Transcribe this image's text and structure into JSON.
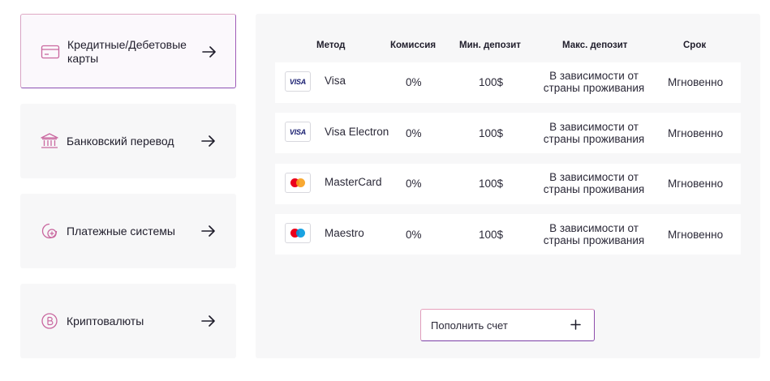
{
  "sidebar": {
    "items": [
      {
        "label_line1": "Кредитные/Дебетовые",
        "label_line2": "карты",
        "icon": "credit-card-icon",
        "active": true
      },
      {
        "label": "Банковский перевод",
        "icon": "bank-icon"
      },
      {
        "label": "Платежные системы",
        "icon": "payment-systems-icon"
      },
      {
        "label": "Криптовалюты",
        "icon": "crypto-icon"
      }
    ]
  },
  "table": {
    "headers": {
      "method": "Метод",
      "fee": "Комиссия",
      "min": "Мин. депозит",
      "max": "Макс. депозит",
      "time": "Срок"
    },
    "rows": [
      {
        "logo": "visa-logo",
        "method": "Visa",
        "fee": "0%",
        "min": "100$",
        "max_line1": "В зависимости от",
        "max_line2": "страны проживания",
        "time": "Мгновенно"
      },
      {
        "logo": "visa-logo",
        "method": "Visa Electron",
        "fee": "0%",
        "min": "100$",
        "max_line1": "В зависимости от",
        "max_line2": "страны проживания",
        "time": "Мгновенно"
      },
      {
        "logo": "mastercard-logo",
        "method": "MasterCard",
        "fee": "0%",
        "min": "100$",
        "max_line1": "В зависимости от",
        "max_line2": "страны проживания",
        "time": "Мгновенно"
      },
      {
        "logo": "maestro-logo",
        "method": "Maestro",
        "fee": "0%",
        "min": "100$",
        "max_line1": "В зависимости от",
        "max_line2": "страны проживания",
        "time": "Мгновенно"
      }
    ],
    "logo_text": {
      "visa": "VISA"
    }
  },
  "topup_button": {
    "label": "Пополнить счет",
    "icon": "plus-icon"
  },
  "colors": {
    "accent_pink": "#e7a1bd",
    "accent_purple": "#8e4dac",
    "panel_bg": "#f7f7f8",
    "mastercard_red": "#eb001b",
    "mastercard_orange": "#f79e1b",
    "maestro_blue": "#0099df"
  }
}
